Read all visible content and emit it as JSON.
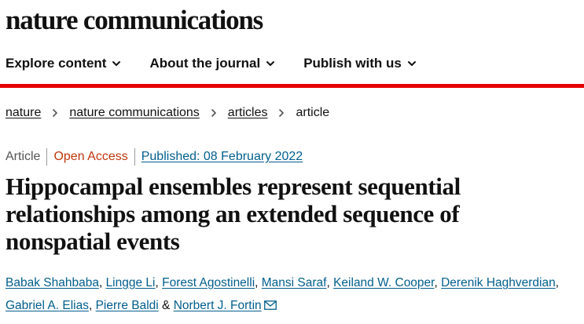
{
  "brand": {
    "title": "nature communications"
  },
  "nav": {
    "items": [
      {
        "label": "Explore content",
        "icon": "chevron-down-icon"
      },
      {
        "label": "About the journal",
        "icon": "chevron-down-icon"
      },
      {
        "label": "Publish with us",
        "icon": "chevron-down-icon"
      }
    ]
  },
  "breadcrumb": {
    "items": [
      "nature",
      "nature communications",
      "articles"
    ],
    "current": "article",
    "separator_icon": "chevron-right-icon"
  },
  "meta": {
    "type": "Article",
    "access": "Open Access",
    "published": "Published: 08 February 2022"
  },
  "article": {
    "title": "Hippocampal ensembles represent sequential relationships among an extended sequence of nonspatial events"
  },
  "authors": {
    "names": [
      "Babak Shahbaba",
      "Lingge Li",
      "Forest Agostinelli",
      "Mansi Saraf",
      "Keiland W. Cooper",
      "Derenik Haghverdian",
      "Gabriel A. Elias",
      "Pierre Baldi",
      "Norbert J. Fortin"
    ],
    "comma": ",",
    "and": "&",
    "contact_icon": "mail-icon"
  },
  "colors": {
    "accent_bar": "#e60000",
    "open_access": "#c0360c",
    "link": "#025e8d",
    "text": "#111111"
  }
}
